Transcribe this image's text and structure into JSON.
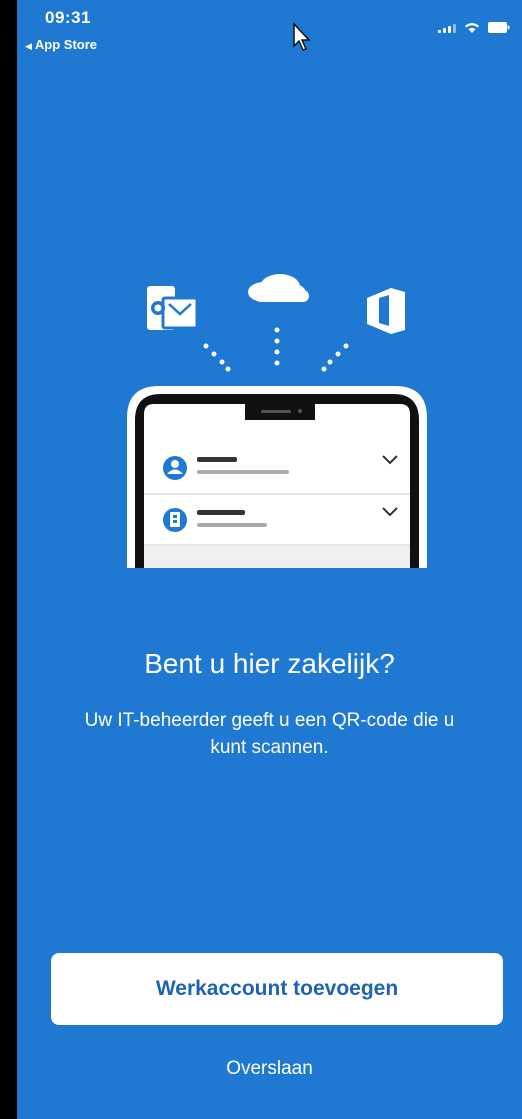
{
  "status_bar": {
    "time": "09:31",
    "back_label": "App Store"
  },
  "illustration": {
    "icons": [
      "outlook-icon",
      "onedrive-icon",
      "office-icon"
    ]
  },
  "main": {
    "title": "Bent u hier zakelijk?",
    "subtitle": "Uw IT-beheerder geeft u een QR-code die u kunt scannen."
  },
  "actions": {
    "primary_label": "Werkaccount toevoegen",
    "skip_label": "Overslaan"
  },
  "colors": {
    "background": "#1f78d2",
    "button_text": "#1f63b3"
  }
}
